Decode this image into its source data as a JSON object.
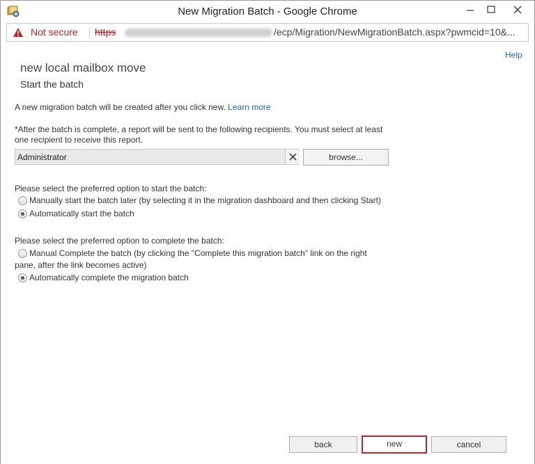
{
  "window": {
    "title": "New Migration Batch - Google Chrome",
    "app_icon": "exchange-app-icon"
  },
  "addressbar": {
    "security_label": "Not secure",
    "scheme": "https",
    "path": "/ecp/Migration/NewMigrationBatch.aspx?pwmcid=10&..."
  },
  "page": {
    "help_label": "Help",
    "heading": "new local mailbox move",
    "subheading": "Start the batch",
    "intro_text": "A new migration batch will be created after you click new.",
    "learn_more": "Learn more",
    "report_text_line1": "*After the batch is complete, a report will be sent to the following recipients. You must select at least",
    "report_text_line2": "one recipient to receive this report.",
    "recipient_value": "Administrator",
    "browse_label": "browse...",
    "start_prompt": "Please select the preferred option to start the batch:",
    "start_options": [
      {
        "label": "Manually start the batch later (by selecting it in the migration dashboard and then clicking Start)",
        "checked": false
      },
      {
        "label": "Automatically start the batch",
        "checked": true
      }
    ],
    "complete_prompt": "Please select the preferred option to complete the batch:",
    "complete_options": [
      {
        "label_line1": "Manual Complete the batch (by clicking the \"Complete this migration batch\" link on the right",
        "label_line2": "pane, after the link becomes active)",
        "checked": false
      },
      {
        "label_line1": "Automatically complete the migration batch",
        "label_line2": "",
        "checked": true
      }
    ]
  },
  "footer": {
    "back_label": "back",
    "new_label": "new",
    "cancel_label": "cancel"
  },
  "colors": {
    "accent_link": "#1e6ea8",
    "warning_red": "#c5221f",
    "highlight_red": "#c8202f"
  }
}
